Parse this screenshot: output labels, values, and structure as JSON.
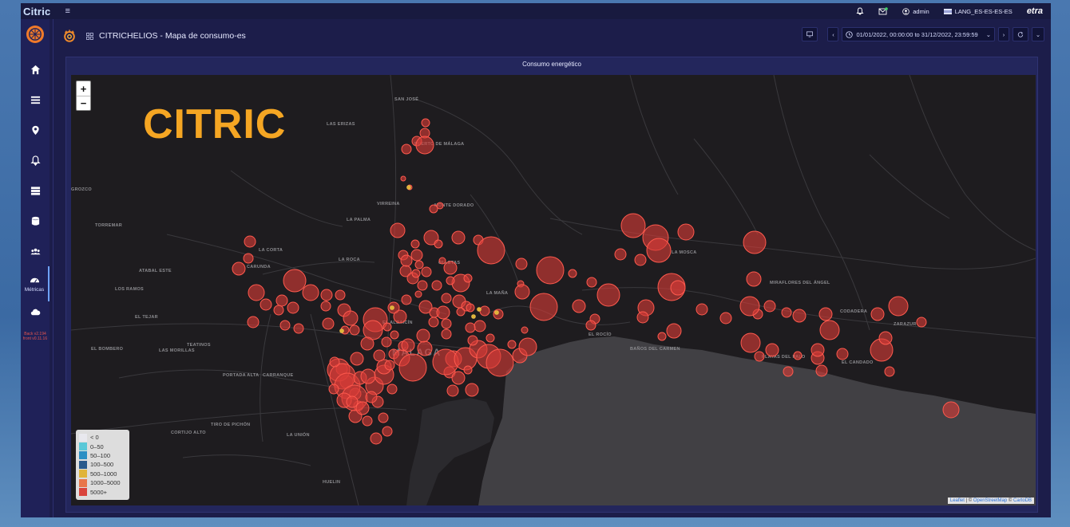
{
  "app": {
    "brand": "Citric",
    "vendor": "etra"
  },
  "topbar": {
    "user": "admin",
    "language": "LANG_ES-ES-ES-ES"
  },
  "sidebar": {
    "items": [
      {
        "icon": "home-icon"
      },
      {
        "icon": "list-icon"
      },
      {
        "icon": "location-pin-icon"
      },
      {
        "icon": "bell-icon"
      },
      {
        "icon": "server-icon"
      },
      {
        "icon": "database-icon"
      },
      {
        "icon": "users-icon"
      },
      {
        "icon": "gauge-icon",
        "label": "Métricas",
        "active": true
      },
      {
        "icon": "cloud-icon"
      }
    ],
    "version_back": "Back v2.194",
    "version_front": "front v0.11.16"
  },
  "dashboard": {
    "title": "CITRICHELIOS - Mapa de consumo-es",
    "time_range": "01/01/2022, 00:00:00 to 31/12/2022, 23:59:59"
  },
  "panel": {
    "title": "Consumo energético",
    "watermark": "CITRIC",
    "attribution": {
      "leaflet": "Leaflet",
      "osm": "OpenStreetMap",
      "carto": "CartoDB"
    },
    "legend": [
      {
        "label": "< 0",
        "color": "#e8e8ee"
      },
      {
        "label": "0–50",
        "color": "#5ac8d8"
      },
      {
        "label": "50–100",
        "color": "#2b8fc4"
      },
      {
        "label": "100–500",
        "color": "#2a5a8c"
      },
      {
        "label": "500–1000",
        "color": "#e0b43a"
      },
      {
        "label": "1000–5000",
        "color": "#e8764a"
      },
      {
        "label": "5000+",
        "color": "#d9443c"
      }
    ],
    "map_labels": [
      "SAN JOSÉ",
      "LAS ERIZAS",
      "PUERTO DE MÁLAGA",
      "LA PALMA",
      "VIRREINA",
      "MONTE DORADO",
      "LA CORTA",
      "LA ROCA",
      "OLLETAS",
      "CARUNDA",
      "ATABAL ESTE",
      "LOS RAMOS",
      "EL TEJAR",
      "EL BOMBERO",
      "LAS MORILLAS",
      "TEATINOS",
      "PORTADA ALTA",
      "CARRANQUE",
      "LA MAÑA",
      "EL ROCÍO",
      "BAÑOS DEL CARMEN",
      "LA MOSCA",
      "MIRAFLORES DEL ÁNGEL",
      "PLAYAS DEL PALO",
      "EL CANDADO",
      "ZARAZUR",
      "CODADERA",
      "CORTIJO ALTO",
      "LA UNIÓN",
      "TIRO DE PICHÓN",
      "HUELIN",
      "GROZCO",
      "TORREMAR",
      "EL ALBAICÍN"
    ],
    "city_label": "MÁLAGA"
  }
}
